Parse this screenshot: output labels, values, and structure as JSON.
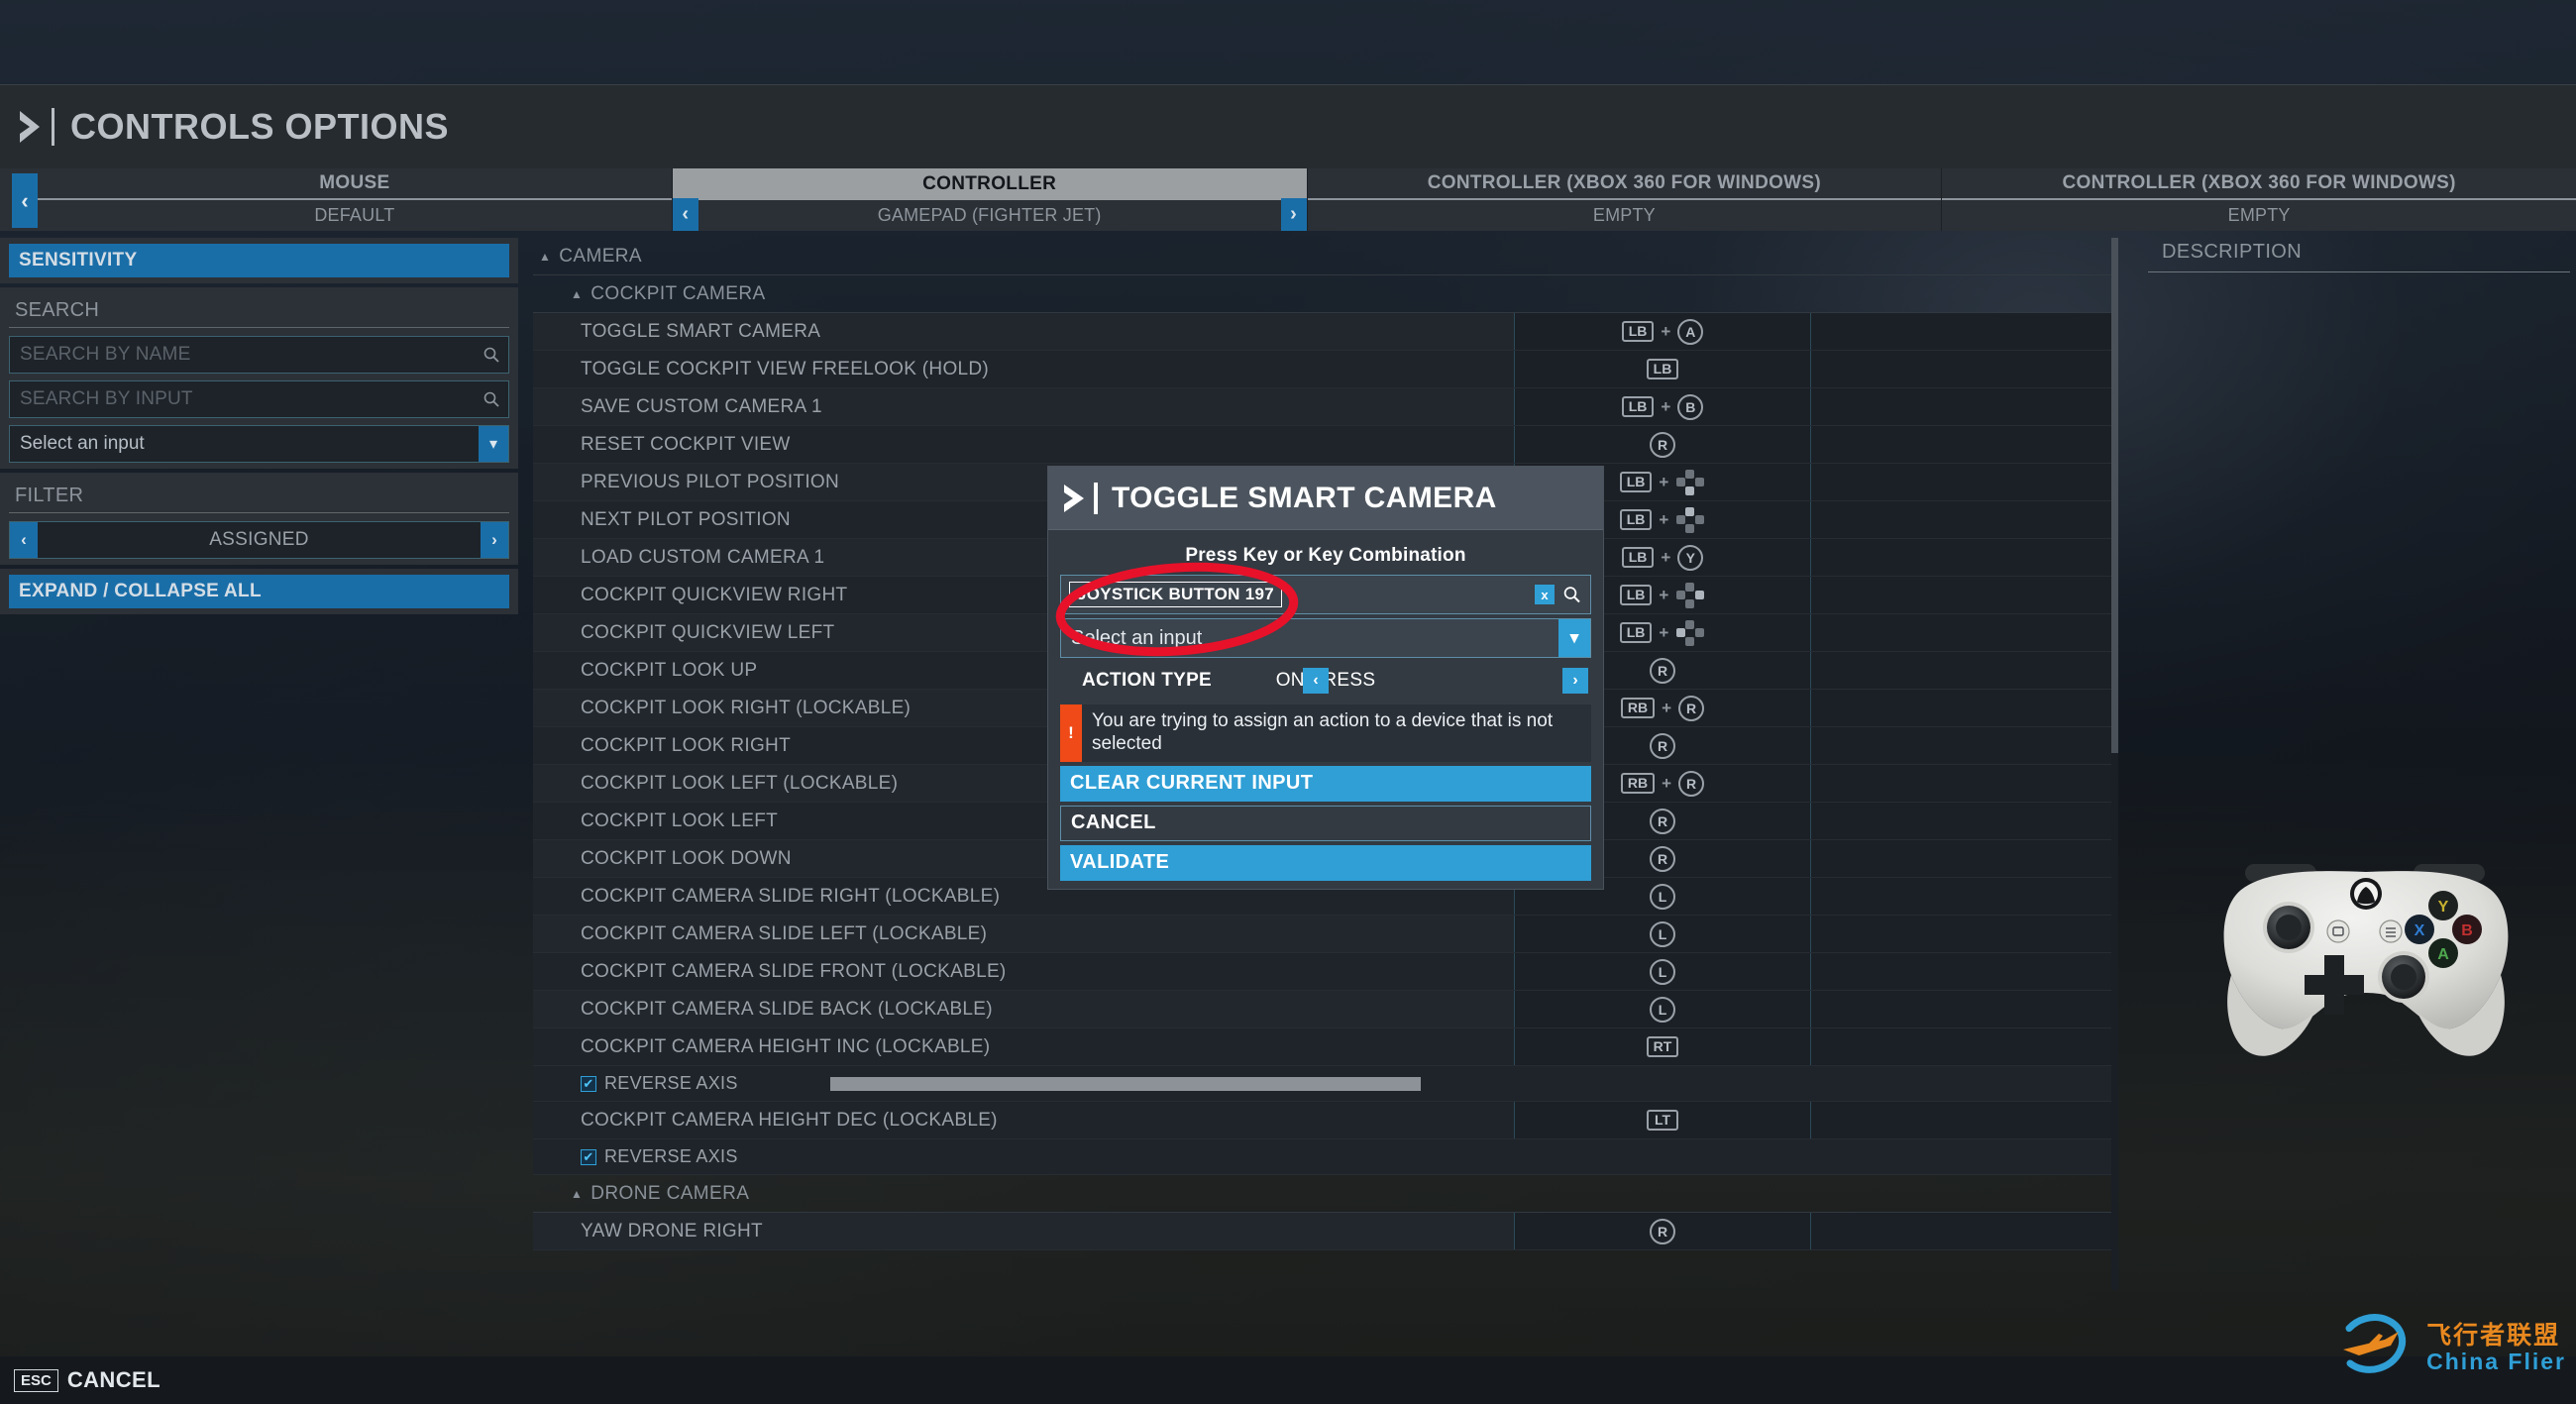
{
  "header": {
    "title": "CONTROLS OPTIONS",
    "chevron_icon": "chevron-right-icon"
  },
  "tabs": [
    {
      "name": "MOUSE",
      "sub": "DEFAULT",
      "active": false
    },
    {
      "name": "CONTROLLER",
      "sub": "GAMEPAD (FIGHTER JET)",
      "active": true
    },
    {
      "name": "CONTROLLER (XBOX 360 FOR WINDOWS)",
      "sub": "EMPTY",
      "active": false
    },
    {
      "name": "CONTROLLER (XBOX 360 FOR WINDOWS)",
      "sub": "EMPTY",
      "active": false
    }
  ],
  "tab_nav": {
    "prev": "‹",
    "next": "›"
  },
  "sidebar": {
    "sensitivity_label": "SENSITIVITY",
    "search_label": "SEARCH",
    "search_by_name_placeholder": "SEARCH BY NAME",
    "search_by_name_value": "",
    "search_by_input_placeholder": "SEARCH BY INPUT",
    "search_by_input_value": "",
    "select_input_value": "Select an input",
    "filter_label": "FILTER",
    "filter_value": "ASSIGNED",
    "expand_collapse_label": "EXPAND / COLLAPSE ALL"
  },
  "description": {
    "title": "DESCRIPTION",
    "body": ""
  },
  "list": {
    "groups": [
      {
        "level": 1,
        "label": "CAMERA"
      },
      {
        "level": 2,
        "label": "COCKPIT CAMERA"
      }
    ],
    "rows": [
      {
        "name": "TOGGLE SMART CAMERA",
        "binding": {
          "bumper": "LB",
          "face": "A"
        }
      },
      {
        "name": "TOGGLE COCKPIT VIEW FREELOOK (HOLD)",
        "binding": {
          "bumper": "LB"
        }
      },
      {
        "name": "SAVE CUSTOM CAMERA 1",
        "binding": {
          "bumper": "LB",
          "face": "B"
        }
      },
      {
        "name": "RESET COCKPIT VIEW",
        "binding": {
          "face": "R"
        }
      },
      {
        "name": "PREVIOUS PILOT POSITION",
        "binding": {
          "bumper": "LB",
          "dpad": "down"
        }
      },
      {
        "name": "NEXT PILOT POSITION",
        "binding": {
          "bumper": "LB",
          "dpad": "up"
        }
      },
      {
        "name": "LOAD CUSTOM CAMERA 1",
        "binding": {
          "bumper": "LB",
          "face": "Y"
        }
      },
      {
        "name": "COCKPIT QUICKVIEW RIGHT",
        "binding": {
          "bumper": "LB",
          "dpad": "right"
        }
      },
      {
        "name": "COCKPIT QUICKVIEW LEFT",
        "binding": {
          "bumper": "LB",
          "dpad": "left"
        }
      },
      {
        "name": "COCKPIT LOOK UP",
        "binding": {
          "face": "R"
        }
      },
      {
        "name": "COCKPIT LOOK RIGHT (LOCKABLE)",
        "binding": {
          "bumper": "RB",
          "face": "R"
        }
      },
      {
        "name": "COCKPIT LOOK RIGHT",
        "binding": {
          "face": "R"
        }
      },
      {
        "name": "COCKPIT LOOK LEFT (LOCKABLE)",
        "binding": {
          "bumper": "RB",
          "face": "R"
        }
      },
      {
        "name": "COCKPIT LOOK LEFT",
        "binding": {
          "face": "R"
        }
      },
      {
        "name": "COCKPIT LOOK DOWN",
        "binding": {
          "face": "R"
        }
      },
      {
        "name": "COCKPIT CAMERA SLIDE RIGHT (LOCKABLE)",
        "binding": {
          "face": "L"
        }
      },
      {
        "name": "COCKPIT CAMERA SLIDE LEFT (LOCKABLE)",
        "binding": {
          "face": "L"
        }
      },
      {
        "name": "COCKPIT CAMERA SLIDE FRONT (LOCKABLE)",
        "binding": {
          "face": "L"
        }
      },
      {
        "name": "COCKPIT CAMERA SLIDE BACK (LOCKABLE)",
        "binding": {
          "face": "L"
        }
      },
      {
        "name": "COCKPIT CAMERA HEIGHT INC (LOCKABLE)",
        "binding": {
          "bumper": "RT"
        },
        "sub": {
          "checkbox_label": "REVERSE AXIS",
          "checked": true,
          "slider_pct": 67
        }
      },
      {
        "name": "COCKPIT CAMERA HEIGHT DEC (LOCKABLE)",
        "binding": {
          "bumper": "LT"
        },
        "sub": {
          "checkbox_label": "REVERSE AXIS",
          "checked": true,
          "slider_pct": 0
        }
      }
    ],
    "group2": {
      "level": 2,
      "label": "DRONE CAMERA"
    },
    "rows2": [
      {
        "name": "YAW DRONE RIGHT",
        "binding": {
          "face": "R"
        }
      }
    ]
  },
  "modal": {
    "title": "TOGGLE SMART CAMERA",
    "chevron_icon": "chevron-right-icon",
    "prompt": "Press Key or Key Combination",
    "key_value": "JOYSTICK BUTTON 197",
    "clear_icon": "x",
    "search_icon": "magnifier-icon",
    "select_value": "Select an input",
    "action_type_label": "ACTION TYPE",
    "action_type_value": "ON PRESS",
    "prev_arrow": "‹",
    "next_arrow": "›",
    "warning_icon": "!",
    "warning_text": "You are trying to assign an action to a device that is not selected",
    "clear_button": "CLEAR CURRENT INPUT",
    "cancel_button": "CANCEL",
    "validate_button": "VALIDATE"
  },
  "bottom": {
    "key": "ESC",
    "label": "CANCEL"
  },
  "watermark": {
    "cn": "飞行者联盟",
    "en": "China Flier",
    "icon": "plane-orbit-logo"
  },
  "colors": {
    "accent_blue": "#1a6ea8",
    "bright_blue": "#2f9fd6",
    "warn_orange": "#ef4a17",
    "annotation_red": "#e8112a",
    "panel": "#2c3137",
    "text_dim": "#8d949b"
  }
}
